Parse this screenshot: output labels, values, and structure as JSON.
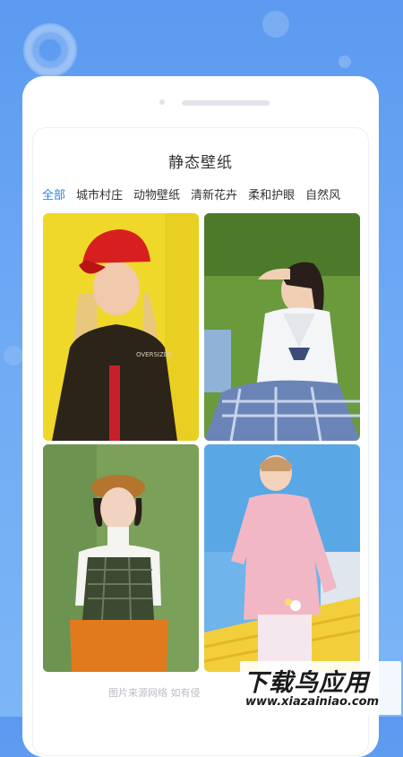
{
  "page_title": "静态壁纸",
  "tabs": [
    {
      "label": "全部",
      "active": true
    },
    {
      "label": "城市村庄",
      "active": false
    },
    {
      "label": "动物壁纸",
      "active": false
    },
    {
      "label": "清新花卉",
      "active": false
    },
    {
      "label": "柔和护眼",
      "active": false
    },
    {
      "label": "自然风",
      "active": false
    }
  ],
  "jacket_text": "OVERSIZED",
  "footer_note": "图片来源网络 如有侵",
  "watermark": {
    "cn": "下载鸟应用",
    "url": "www.xiazainiao.com"
  },
  "colors": {
    "accent": "#2f86e6",
    "background": "#6ea9f4"
  }
}
